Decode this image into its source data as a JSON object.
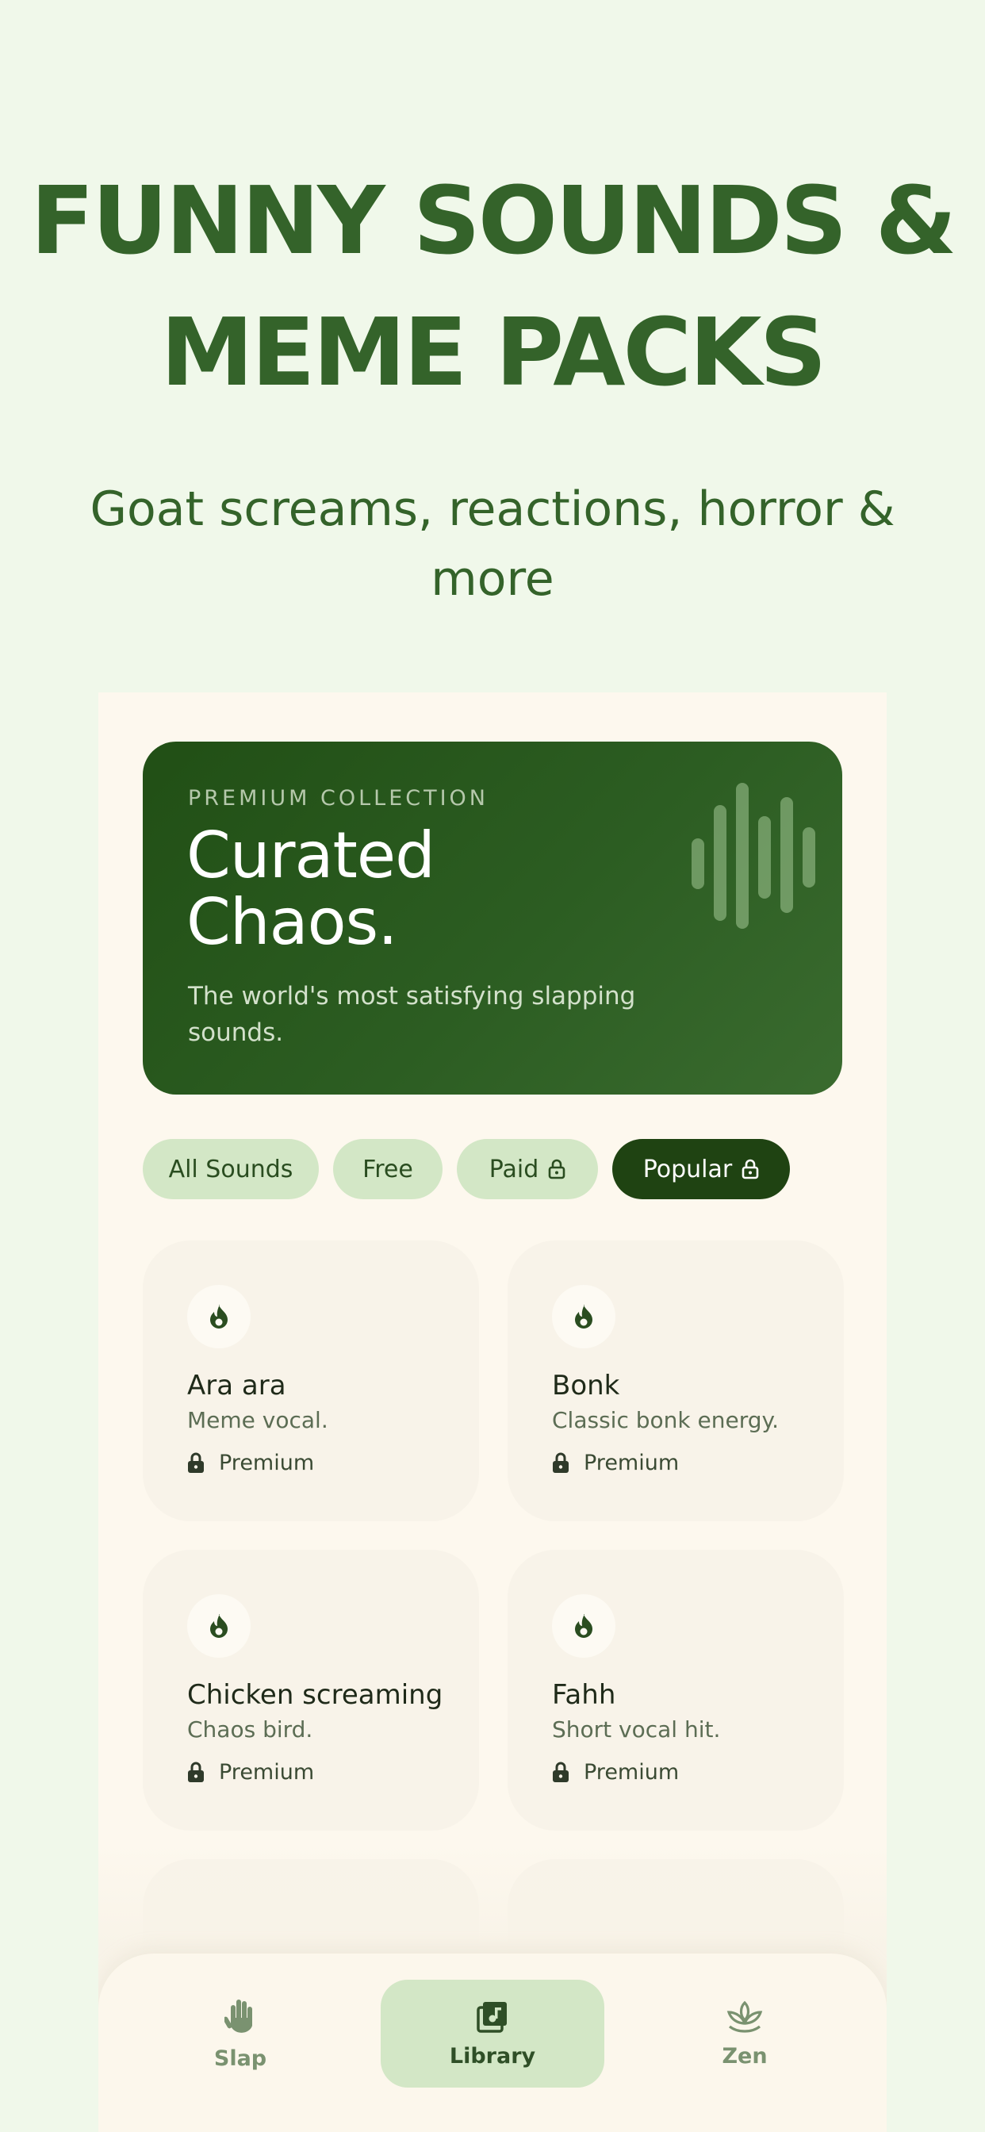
{
  "hero": {
    "title_line1": "FUNNY SOUNDS &",
    "title_line2": "MEME PACKS",
    "subtitle": "Goat screams, reactions, horror & more"
  },
  "banner": {
    "eyebrow": "PREMIUM COLLECTION",
    "title_line1": "Curated",
    "title_line2": "Chaos.",
    "description": "The world's most satisfying slapping sounds.",
    "icon": "waveform-icon"
  },
  "filters": [
    {
      "label": "All Sounds",
      "locked": false,
      "active": false
    },
    {
      "label": "Free",
      "locked": false,
      "active": false
    },
    {
      "label": "Paid",
      "locked": true,
      "active": false
    },
    {
      "label": "Popular",
      "locked": true,
      "active": true
    }
  ],
  "sounds": [
    {
      "name": "Ara ara",
      "description": "Meme vocal.",
      "tier": "Premium",
      "icon": "flame-icon"
    },
    {
      "name": "Bonk",
      "description": "Classic bonk energy.",
      "tier": "Premium",
      "icon": "flame-icon"
    },
    {
      "name": "Chicken screaming",
      "description": "Chaos bird.",
      "tier": "Premium",
      "icon": "flame-icon"
    },
    {
      "name": "Fahh",
      "description": "Short vocal hit.",
      "tier": "Premium",
      "icon": "flame-icon"
    }
  ],
  "nav": {
    "items": [
      {
        "label": "Slap",
        "icon": "hand-icon",
        "active": false
      },
      {
        "label": "Library",
        "icon": "music-library-icon",
        "active": true
      },
      {
        "label": "Zen",
        "icon": "lotus-icon",
        "active": false
      }
    ]
  },
  "colors": {
    "page_bg": "#f0f8ea",
    "accent_dark": "#1f4312",
    "headline": "#34632a",
    "chip_bg": "#d3e7c6",
    "panel_bg": "#fdf8ee"
  }
}
